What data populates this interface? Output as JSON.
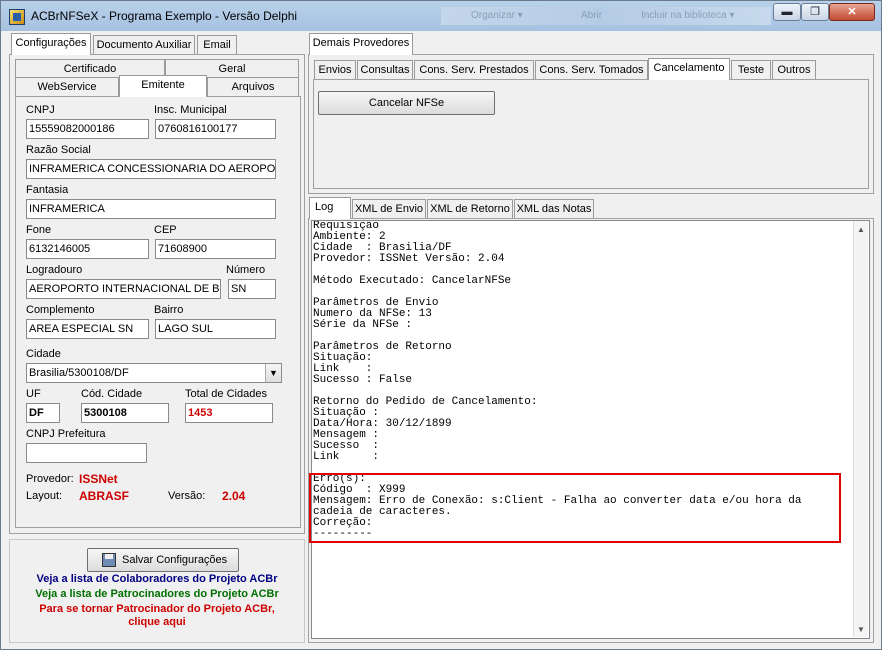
{
  "window": {
    "title": "ACBrNFSeX - Programa Exemplo - Versão Delphi",
    "bg_ghost": [
      "Organizar ▾",
      "Abrir",
      "Incluir na biblioteca ▾"
    ],
    "min": "▬",
    "max": "❐",
    "close": "✕"
  },
  "left": {
    "top_tabs": [
      "Configurações",
      "Documento Auxiliar",
      "Email"
    ],
    "sub_tabs_row1": [
      "Certificado",
      "Geral"
    ],
    "sub_tabs_row2": [
      "WebService",
      "Emitente",
      "Arquivos"
    ],
    "form": {
      "cnpj_label": "CNPJ",
      "cnpj": "15559082000186",
      "im_label": "Insc. Municipal",
      "im": "0760816100177",
      "razao_label": "Razão Social",
      "razao": "INFRAMERICA CONCESSIONARIA DO AEROPORTO",
      "fantasia_label": "Fantasia",
      "fantasia": "INFRAMERICA",
      "fone_label": "Fone",
      "fone": "6132146005",
      "cep_label": "CEP",
      "cep": "71608900",
      "logradouro_label": "Logradouro",
      "logradouro": "AEROPORTO INTERNACIONAL DE BRASILIA",
      "numero_label": "Número",
      "numero": "SN",
      "complemento_label": "Complemento",
      "complemento": "AREA ESPECIAL SN",
      "bairro_label": "Bairro",
      "bairro": "LAGO SUL",
      "cidade_label": "Cidade",
      "cidade": "Brasilia/5300108/DF",
      "uf_label": "UF",
      "uf": "DF",
      "cod_cidade_label": "Cód. Cidade",
      "cod_cidade": "5300108",
      "total_cidades_label": "Total de Cidades",
      "total_cidades": "1453",
      "cnpj_pref_label": "CNPJ Prefeitura",
      "cnpj_pref": "",
      "provedor_label": "Provedor:",
      "provedor": "ISSNet",
      "layout_label": "Layout:",
      "layout": "ABRASF",
      "versao_label": "Versão:",
      "versao": "2.04"
    },
    "save_button": "Salvar Configurações",
    "links": {
      "colaboradores": "Veja a lista de Colaboradores do Projeto ACBr",
      "patrocinadores": "Veja a lista de Patrocinadores do Projeto ACBr",
      "tornar1": "Para se tornar Patrocinador do Projeto ACBr,",
      "tornar2": "clique aqui"
    }
  },
  "right": {
    "provider_tab": "Demais Provedores",
    "action_tabs": [
      "Envios",
      "Consultas",
      "Cons. Serv. Prestados",
      "Cons. Serv. Tomados",
      "Cancelamento",
      "Teste",
      "Outros"
    ],
    "cancel_button": "Cancelar NFSe",
    "log_tabs": [
      "Log",
      "XML de Envio",
      "XML de Retorno",
      "XML das Notas"
    ],
    "log_text": "Requisição\nAmbiente: 2\nCidade  : Brasilia/DF\nProvedor: ISSNet Versão: 2.04\n\nMétodo Executado: CancelarNFSe\n\nParâmetros de Envio\nNumero da NFSe: 13\nSérie da NFSe :\n\nParâmetros de Retorno\nSituação:\nLink    :\nSucesso : False\n\nRetorno do Pedido de Cancelamento:\nSituação :\nData/Hora: 30/12/1899\nMensagem :\nSucesso  :\nLink     :\n\nErro(s):\nCódigo  : X999\nMensagem: Erro de Conexão: s:Client - Falha ao converter data e/ou hora da\ncadeia de caracteres.\nCorreção:\n---------"
  },
  "colors": {
    "highlight": "#e00000",
    "red_text": "#cc0000",
    "blue_link": "#000080",
    "green_link": "#007000"
  }
}
